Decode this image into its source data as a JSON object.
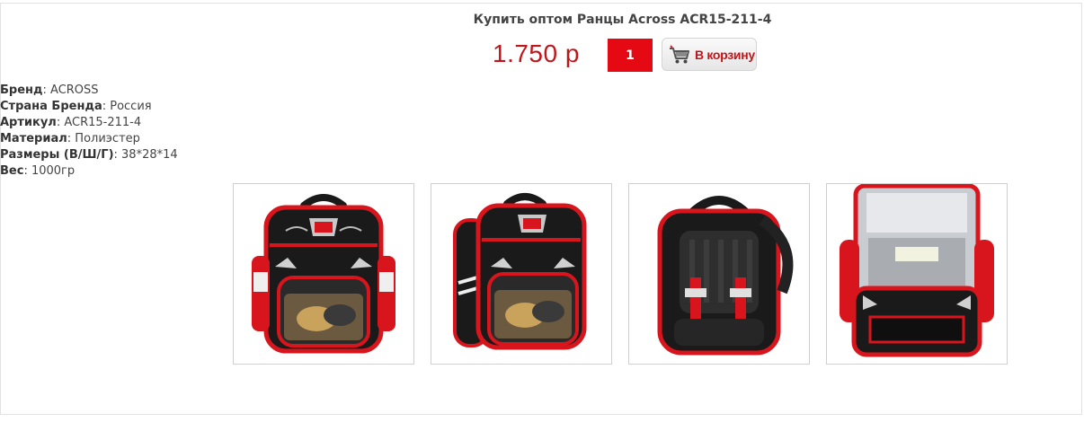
{
  "product": {
    "title": "Купить оптом Ранцы Across ACR15-211-4",
    "price": "1.750 р",
    "quantity": "1",
    "cart_button_label": "В корзину"
  },
  "specs": [
    {
      "key": "Бренд",
      "value": "ACROSS"
    },
    {
      "key": "Страна Бренда",
      "value": "Россия"
    },
    {
      "key": "Артикул",
      "value": "ACR15-211-4"
    },
    {
      "key": "Материал",
      "value": "Полиэстер"
    },
    {
      "key": "Размеры (В/Ш/Г)",
      "value": "38*28*14"
    },
    {
      "key": "Вес",
      "value": "1000гр"
    }
  ],
  "gallery": {
    "images": [
      {
        "view": "front"
      },
      {
        "view": "three-quarter"
      },
      {
        "view": "back"
      },
      {
        "view": "open"
      }
    ]
  },
  "colors": {
    "accent_red": "#e50914",
    "price_red": "#c0161a",
    "bag_black": "#1a1a1a",
    "bag_red": "#d8151c"
  }
}
